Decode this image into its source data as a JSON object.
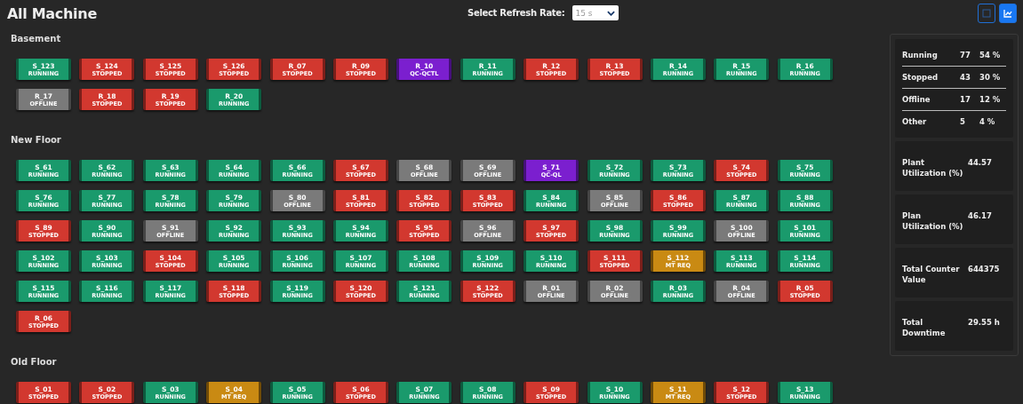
{
  "title": "All Machine",
  "refresh": {
    "label": "Select Refresh Rate:",
    "value": "15 s"
  },
  "view_buttons": [
    {
      "selected": false
    },
    {
      "selected": true
    }
  ],
  "floors": [
    {
      "name": "Basement",
      "machines": [
        {
          "name": "S_123",
          "status": "RUNNING",
          "kind": "running"
        },
        {
          "name": "S_124",
          "status": "STOPPED",
          "kind": "stopped"
        },
        {
          "name": "S_125",
          "status": "STOPPED",
          "kind": "stopped"
        },
        {
          "name": "S_126",
          "status": "STOPPED",
          "kind": "stopped"
        },
        {
          "name": "R_07",
          "status": "STOPPED",
          "kind": "stopped"
        },
        {
          "name": "R_09",
          "status": "STOPPED",
          "kind": "stopped"
        },
        {
          "name": "R_10",
          "status": "QC-QCTL",
          "kind": "qc"
        },
        {
          "name": "R_11",
          "status": "RUNNING",
          "kind": "running"
        },
        {
          "name": "R_12",
          "status": "STOPPED",
          "kind": "stopped"
        },
        {
          "name": "R_13",
          "status": "STOPPED",
          "kind": "stopped"
        },
        {
          "name": "R_14",
          "status": "RUNNING",
          "kind": "running"
        },
        {
          "name": "R_15",
          "status": "RUNNING",
          "kind": "running"
        },
        {
          "name": "R_16",
          "status": "RUNNING",
          "kind": "running"
        },
        {
          "name": "R_17",
          "status": "OFFLINE",
          "kind": "offline"
        },
        {
          "name": "R_18",
          "status": "STOPPED",
          "kind": "stopped"
        },
        {
          "name": "R_19",
          "status": "STOPPED",
          "kind": "stopped"
        },
        {
          "name": "R_20",
          "status": "RUNNING",
          "kind": "running"
        }
      ]
    },
    {
      "name": "New Floor",
      "machines": [
        {
          "name": "S_61",
          "status": "RUNNING",
          "kind": "running"
        },
        {
          "name": "S_62",
          "status": "RUNNING",
          "kind": "running"
        },
        {
          "name": "S_63",
          "status": "RUNNING",
          "kind": "running"
        },
        {
          "name": "S_64",
          "status": "RUNNING",
          "kind": "running"
        },
        {
          "name": "S_66",
          "status": "RUNNING",
          "kind": "running"
        },
        {
          "name": "S_67",
          "status": "STOPPED",
          "kind": "stopped"
        },
        {
          "name": "S_68",
          "status": "OFFLINE",
          "kind": "offline"
        },
        {
          "name": "S_69",
          "status": "OFFLINE",
          "kind": "offline"
        },
        {
          "name": "S_71",
          "status": "QC-QL",
          "kind": "qc"
        },
        {
          "name": "S_72",
          "status": "RUNNING",
          "kind": "running"
        },
        {
          "name": "S_73",
          "status": "RUNNING",
          "kind": "running"
        },
        {
          "name": "S_74",
          "status": "STOPPED",
          "kind": "stopped"
        },
        {
          "name": "S_75",
          "status": "RUNNING",
          "kind": "running"
        },
        {
          "name": "S_76",
          "status": "RUNNING",
          "kind": "running"
        },
        {
          "name": "S_77",
          "status": "RUNNING",
          "kind": "running"
        },
        {
          "name": "S_78",
          "status": "RUNNING",
          "kind": "running"
        },
        {
          "name": "S_79",
          "status": "RUNNING",
          "kind": "running"
        },
        {
          "name": "S_80",
          "status": "OFFLINE",
          "kind": "offline"
        },
        {
          "name": "S_81",
          "status": "STOPPED",
          "kind": "stopped"
        },
        {
          "name": "S_82",
          "status": "STOPPED",
          "kind": "stopped"
        },
        {
          "name": "S_83",
          "status": "STOPPED",
          "kind": "stopped"
        },
        {
          "name": "S_84",
          "status": "RUNNING",
          "kind": "running"
        },
        {
          "name": "S_85",
          "status": "OFFLINE",
          "kind": "offline"
        },
        {
          "name": "S_86",
          "status": "STOPPED",
          "kind": "stopped"
        },
        {
          "name": "S_87",
          "status": "RUNNING",
          "kind": "running"
        },
        {
          "name": "S_88",
          "status": "RUNNING",
          "kind": "running"
        },
        {
          "name": "S_89",
          "status": "STOPPED",
          "kind": "stopped"
        },
        {
          "name": "S_90",
          "status": "RUNNING",
          "kind": "running"
        },
        {
          "name": "S_91",
          "status": "OFFLINE",
          "kind": "offline"
        },
        {
          "name": "S_92",
          "status": "RUNNING",
          "kind": "running"
        },
        {
          "name": "S_93",
          "status": "RUNNING",
          "kind": "running"
        },
        {
          "name": "S_94",
          "status": "RUNNING",
          "kind": "running"
        },
        {
          "name": "S_95",
          "status": "STOPPED",
          "kind": "stopped"
        },
        {
          "name": "S_96",
          "status": "OFFLINE",
          "kind": "offline"
        },
        {
          "name": "S_97",
          "status": "STOPPED",
          "kind": "stopped"
        },
        {
          "name": "S_98",
          "status": "RUNNING",
          "kind": "running"
        },
        {
          "name": "S_99",
          "status": "RUNNING",
          "kind": "running"
        },
        {
          "name": "S_100",
          "status": "OFFLINE",
          "kind": "offline"
        },
        {
          "name": "S_101",
          "status": "RUNNING",
          "kind": "running"
        },
        {
          "name": "S_102",
          "status": "RUNNING",
          "kind": "running"
        },
        {
          "name": "S_103",
          "status": "RUNNING",
          "kind": "running"
        },
        {
          "name": "S_104",
          "status": "STOPPED",
          "kind": "stopped"
        },
        {
          "name": "S_105",
          "status": "RUNNING",
          "kind": "running"
        },
        {
          "name": "S_106",
          "status": "RUNNING",
          "kind": "running"
        },
        {
          "name": "S_107",
          "status": "RUNNING",
          "kind": "running"
        },
        {
          "name": "S_108",
          "status": "RUNNING",
          "kind": "running"
        },
        {
          "name": "S_109",
          "status": "RUNNING",
          "kind": "running"
        },
        {
          "name": "S_110",
          "status": "RUNNING",
          "kind": "running"
        },
        {
          "name": "S_111",
          "status": "STOPPED",
          "kind": "stopped"
        },
        {
          "name": "S_112",
          "status": "MT REQ",
          "kind": "maintenance"
        },
        {
          "name": "S_113",
          "status": "RUNNING",
          "kind": "running"
        },
        {
          "name": "S_114",
          "status": "RUNNING",
          "kind": "running"
        },
        {
          "name": "S_115",
          "status": "RUNNING",
          "kind": "running"
        },
        {
          "name": "S_116",
          "status": "RUNNING",
          "kind": "running"
        },
        {
          "name": "S_117",
          "status": "RUNNING",
          "kind": "running"
        },
        {
          "name": "S_118",
          "status": "STOPPED",
          "kind": "stopped"
        },
        {
          "name": "S_119",
          "status": "RUNNING",
          "kind": "running"
        },
        {
          "name": "S_120",
          "status": "STOPPED",
          "kind": "stopped"
        },
        {
          "name": "S_121",
          "status": "RUNNING",
          "kind": "running"
        },
        {
          "name": "S_122",
          "status": "STOPPED",
          "kind": "stopped"
        },
        {
          "name": "R_01",
          "status": "OFFLINE",
          "kind": "offline"
        },
        {
          "name": "R_02",
          "status": "OFFLINE",
          "kind": "offline"
        },
        {
          "name": "R_03",
          "status": "RUNNING",
          "kind": "running"
        },
        {
          "name": "R_04",
          "status": "OFFLINE",
          "kind": "offline"
        },
        {
          "name": "R_05",
          "status": "STOPPED",
          "kind": "stopped"
        },
        {
          "name": "R_06",
          "status": "STOPPED",
          "kind": "stopped"
        }
      ]
    },
    {
      "name": "Old Floor",
      "machines": [
        {
          "name": "S_01",
          "status": "STOPPED",
          "kind": "stopped"
        },
        {
          "name": "S_02",
          "status": "STOPPED",
          "kind": "stopped"
        },
        {
          "name": "S_03",
          "status": "RUNNING",
          "kind": "running"
        },
        {
          "name": "S_04",
          "status": "MT REQ",
          "kind": "maintenance"
        },
        {
          "name": "S_05",
          "status": "RUNNING",
          "kind": "running"
        },
        {
          "name": "S_06",
          "status": "STOPPED",
          "kind": "stopped"
        },
        {
          "name": "S_07",
          "status": "RUNNING",
          "kind": "running"
        },
        {
          "name": "S_08",
          "status": "RUNNING",
          "kind": "running"
        },
        {
          "name": "S_09",
          "status": "STOPPED",
          "kind": "stopped"
        },
        {
          "name": "S_10",
          "status": "RUNNING",
          "kind": "running"
        },
        {
          "name": "S_11",
          "status": "MT REQ",
          "kind": "maintenance"
        },
        {
          "name": "S_12",
          "status": "STOPPED",
          "kind": "stopped"
        },
        {
          "name": "S_13",
          "status": "RUNNING",
          "kind": "running"
        }
      ]
    }
  ],
  "summary": {
    "counts": [
      {
        "label": "Running",
        "count": "77",
        "percent": "54 %"
      },
      {
        "label": "Stopped",
        "count": "43",
        "percent": "30 %"
      },
      {
        "label": "Offline",
        "count": "17",
        "percent": "12 %"
      },
      {
        "label": "Other",
        "count": "5",
        "percent": "4 %"
      }
    ],
    "metrics": [
      {
        "label": "Plant Utilization (%)",
        "value": "44.57"
      },
      {
        "label": "Plan Utilization (%)",
        "value": "46.17"
      },
      {
        "label": "Total Counter Value",
        "value": "644375"
      },
      {
        "label": "Total Downtime",
        "value": "29.55 h"
      }
    ]
  }
}
